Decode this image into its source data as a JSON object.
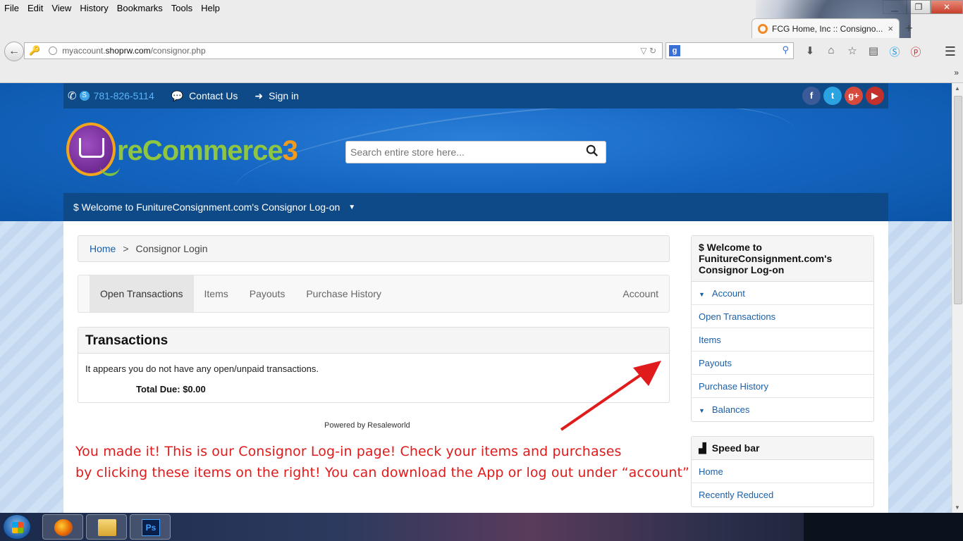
{
  "browser": {
    "menu": [
      "File",
      "Edit",
      "View",
      "History",
      "Bookmarks",
      "Tools",
      "Help"
    ],
    "tab_title": "FCG Home, Inc :: Consigno...",
    "tab_close": "×",
    "new_tab": "+",
    "url_prefix": "myaccount.",
    "url_host": "shoprw.com",
    "url_path": "/consignor.php",
    "url_tools": "▽ ↻",
    "search_engine": "g",
    "win_min": "▁",
    "win_max": "❐",
    "win_close": "✕",
    "overflow": "»",
    "menu_button": "☰"
  },
  "topbar": {
    "phone": "781-826-5114",
    "contact_label": "Contact Us",
    "signin_label": "Sign in",
    "social": [
      "f",
      "t",
      "g+",
      "▶"
    ]
  },
  "logo": {
    "word_a": "reCommerce",
    "word_b": "3"
  },
  "search": {
    "placeholder": "Search entire store here..."
  },
  "welcome_bar": "$ Welcome to FunitureConsignment.com's Consignor Log-on",
  "breadcrumb": {
    "home": "Home",
    "separator": ">",
    "current": "Consignor Login"
  },
  "tabs": {
    "items": [
      "Open Transactions",
      "Items",
      "Payouts",
      "Purchase History"
    ],
    "account": "Account",
    "active": "Open Transactions"
  },
  "transactions": {
    "title": "Transactions",
    "message": "It appears you do not have any open/unpaid transactions.",
    "total_due": "Total Due: $0.00"
  },
  "powered_by": "Powered by Resaleworld",
  "annotation": {
    "line1": "You made it! This is our Consignor Log-in page! Check your items and purchases",
    "line2": "by clicking these items on the right! You can download the App or log out under “account”"
  },
  "sidebar": {
    "title": "$   Welcome to FunitureConsignment.com's Consignor Log-on",
    "items": [
      "Account",
      "Open Transactions",
      "Items",
      "Payouts",
      "Purchase History",
      "Balances"
    ],
    "speed_title": "Speed bar",
    "speed_items": [
      "Home",
      "Recently Reduced"
    ]
  },
  "colors": {
    "brand_dark": "#0e4a88",
    "link": "#1a5fa8",
    "annotation": "#e01b1b"
  },
  "icons": {
    "phone": "phone-icon",
    "skype": "skype-icon",
    "chat": "chat-icon",
    "signin": "signin-icon",
    "search": "search-icon",
    "speedbar": "speedbar-icon"
  }
}
